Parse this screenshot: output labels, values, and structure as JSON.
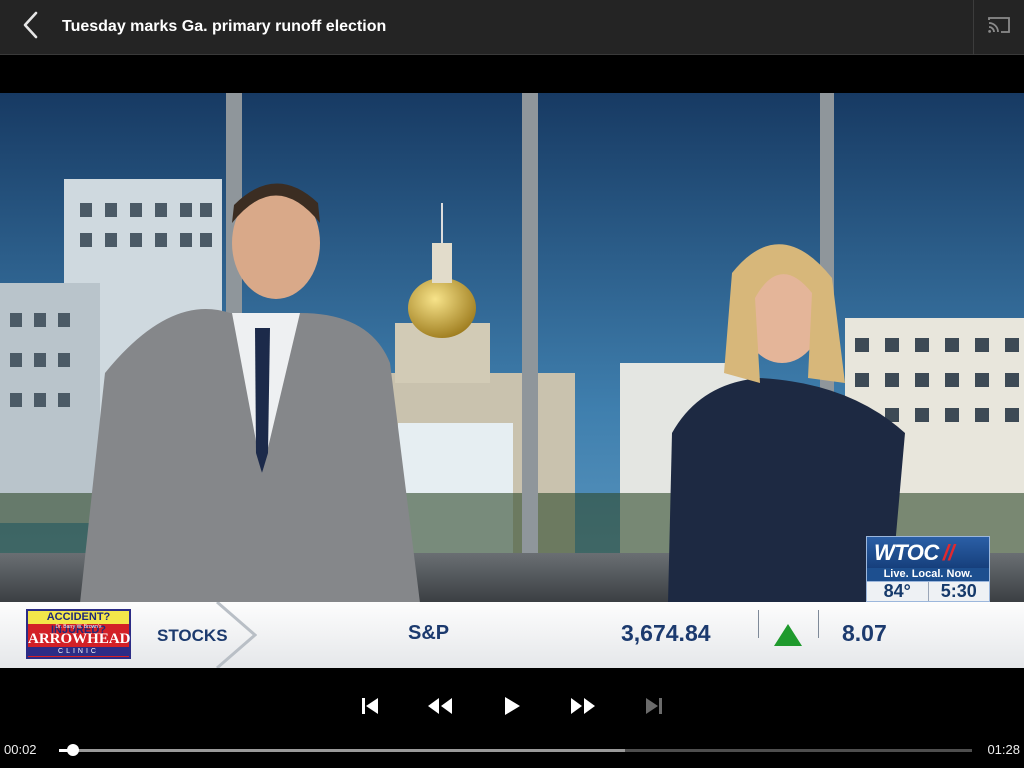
{
  "header": {
    "title": "Tuesday marks Ga. primary runoff election",
    "back_icon": "chevron-left-icon",
    "cast_icon": "cast-icon"
  },
  "video": {
    "station_logo": "WTOC",
    "station_tagline": "Live. Local. Now.",
    "temperature": "84°",
    "clock": "5:30",
    "ticker": {
      "ad_line1": "ACCIDENT? INJURED?",
      "ad_line2": "Dr. Barry W. Brown's",
      "ad_line3": "ARROWHEAD",
      "ad_line4": "CLINIC",
      "section": "STOCKS",
      "index_name": "S&P",
      "index_value": "3,674.84",
      "index_direction": "up",
      "index_change": "8.07"
    },
    "colors": {
      "ticker_text": "#1c3a6e",
      "up_arrow": "#1f9a2d",
      "brand_blue": "#1d4f8f",
      "brand_red": "#e1292f"
    }
  },
  "player": {
    "current_time": "00:02",
    "duration": "01:28",
    "progress_fraction": 0.015,
    "buffered_fraction": 0.62,
    "buttons": [
      "skip-previous-icon",
      "rewind-icon",
      "play-icon",
      "fast-forward-icon",
      "skip-next-icon"
    ]
  }
}
